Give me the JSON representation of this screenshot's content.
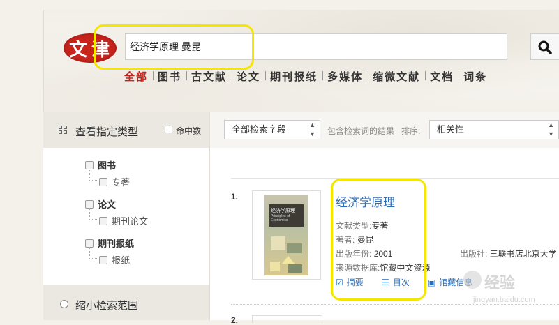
{
  "logo": {
    "chars": [
      "文",
      "津"
    ]
  },
  "search": {
    "query": "经济学原理 曼昆"
  },
  "category_tabs": [
    "全部",
    "图书",
    "古文献",
    "论文",
    "期刊报纸",
    "多媒体",
    "缩微文献",
    "文档",
    "词条"
  ],
  "sidebar": {
    "title": "查看指定类型",
    "hit_count_label": "命中数",
    "types": [
      {
        "label": "图书",
        "children": [
          "专著"
        ]
      },
      {
        "label": "论文",
        "children": [
          "期刊论文"
        ]
      },
      {
        "label": "期刊报纸",
        "children": [
          "报纸"
        ]
      }
    ],
    "footer": "缩小检索范围"
  },
  "toolbar": {
    "field_select": "全部检索字段",
    "within_results": "包含检索词的结果",
    "sort_label": "排序:",
    "sort_select": "相关性"
  },
  "results": [
    {
      "index": "1.",
      "title": "经济学原理",
      "cover_title": "经济学原理",
      "cover_subtitle": "Principles of Economics",
      "type_label": "文献类型:",
      "type_value": "专著",
      "author_label": "著者:",
      "author_value": "曼昆",
      "year_label": "出版年份:",
      "year_value": "2001",
      "publisher_label": "出版社:",
      "publisher_value": "三联书店北京大学",
      "source_label": "来源数据库:",
      "source_value": "馆藏中文资源",
      "actions": [
        "摘要",
        "目次",
        "馆藏信息"
      ]
    },
    {
      "index": "2."
    }
  ],
  "watermark": {
    "text": "经验",
    "url": "jingyan.baidu.com"
  },
  "colors": {
    "brand_red": "#c8241c",
    "link_blue": "#2a6ebb",
    "highlight": "#f5e600"
  }
}
